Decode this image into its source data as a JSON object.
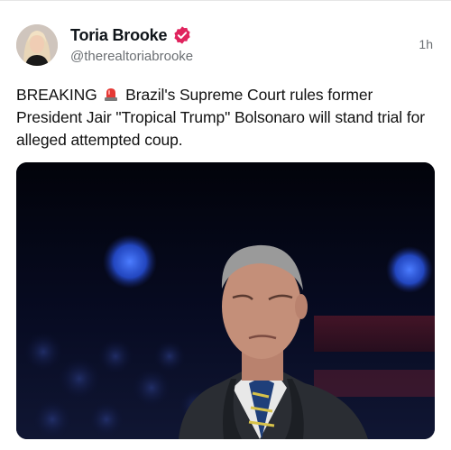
{
  "post": {
    "author": {
      "display_name": "Toria Brooke",
      "handle": "@therealtoriabrooke",
      "verified": true,
      "avatar_icon": "profile-photo"
    },
    "timestamp": "1h",
    "text": {
      "prefix": "BREAKING",
      "emoji_icon": "police-car-light-icon",
      "body": " Brazil's Supreme Court rules former President Jair \"Tropical Trump\" Bolsonaro will stand trial for alleged attempted coup."
    },
    "media": {
      "type": "photo"
    }
  },
  "colors": {
    "verified_badge": "#e0245e",
    "text_primary": "#0f1419",
    "text_secondary": "#6b6f73",
    "media_background": "#05070f"
  }
}
